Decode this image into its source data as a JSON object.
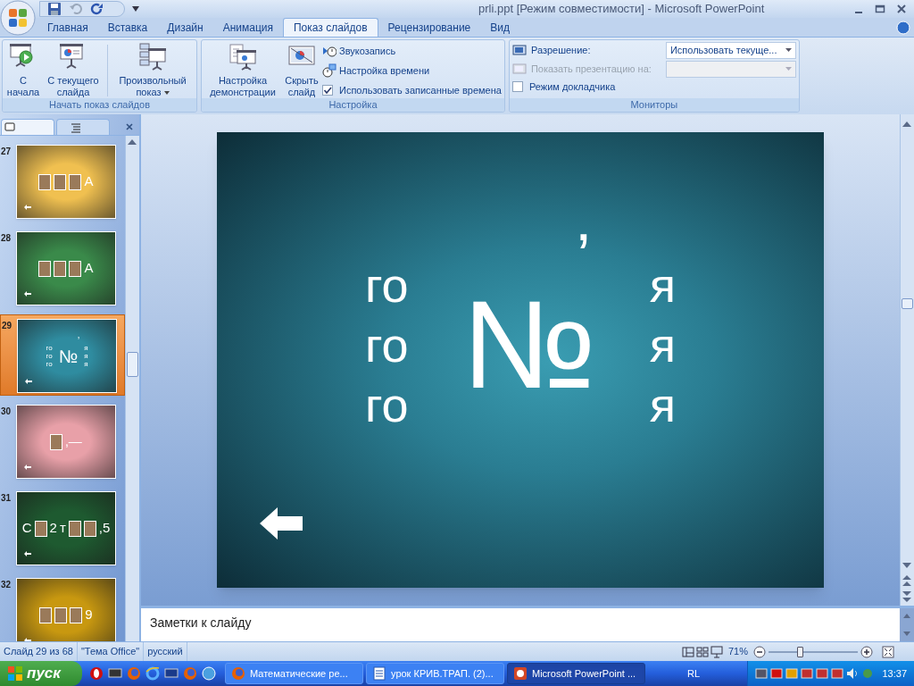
{
  "window": {
    "title": "prli.ppt [Режим совместимости] - Microsoft PowerPoint"
  },
  "tabs": [
    {
      "label": "Главная",
      "selected": false
    },
    {
      "label": "Вставка",
      "selected": false
    },
    {
      "label": "Дизайн",
      "selected": false
    },
    {
      "label": "Анимация",
      "selected": false
    },
    {
      "label": "Показ слайдов",
      "selected": true
    },
    {
      "label": "Рецензирование",
      "selected": false
    },
    {
      "label": "Вид",
      "selected": false
    }
  ],
  "ribbon_groups": [
    {
      "title": "Начать показ слайдов",
      "controls": [
        {
          "kind": "large",
          "label": "С начала"
        },
        {
          "kind": "large",
          "label": "С текущего слайда"
        },
        {
          "kind": "separator"
        },
        {
          "kind": "large",
          "label": "Произвольный показ",
          "dropdown": true
        }
      ]
    },
    {
      "title": "Настройка",
      "controls": [
        {
          "kind": "large",
          "label": "Настройка демонстрации"
        },
        {
          "kind": "large",
          "label": "Скрыть слайд"
        },
        {
          "kind": "small",
          "label": "Звукозапись"
        },
        {
          "kind": "small",
          "label": "Настройка времени"
        },
        {
          "kind": "checkbox",
          "label": "Использовать записанные времена",
          "checked": true
        }
      ]
    },
    {
      "title": "Мониторы",
      "controls": [
        {
          "kind": "select",
          "label": "Разрешение:",
          "value": "Использовать текуще...",
          "disabled": false
        },
        {
          "kind": "select",
          "label": "Показать презентацию на:",
          "disabled": true
        },
        {
          "kind": "checkbox",
          "label": "Режим докладчика",
          "checked": false
        }
      ]
    }
  ],
  "pane_tabs": [
    {
      "selected": true
    },
    {
      "selected": false
    }
  ],
  "thumbnails": [
    {
      "number": "27",
      "selected": false,
      "color": "#f0c050",
      "items": [
        {
          "kind": "photo"
        },
        {
          "kind": "photo"
        },
        {
          "kind": "photo"
        },
        {
          "kind": "text",
          "text": "А"
        }
      ]
    },
    {
      "number": "28",
      "selected": false,
      "color": "#3a8a4a",
      "items": [
        {
          "kind": "photo"
        },
        {
          "kind": "photo"
        },
        {
          "kind": "photo"
        },
        {
          "kind": "text",
          "text": "А"
        }
      ]
    },
    {
      "number": "29",
      "selected": true,
      "color": "#2f8ca0",
      "items": [
        {
          "kind": "stack",
          "texts": [
            "го",
            "го",
            "го"
          ]
        },
        {
          "kind": "accented",
          "text": "№",
          "accent": "ʼ"
        },
        {
          "kind": "stack",
          "texts": [
            "я",
            "я",
            "я"
          ]
        }
      ]
    },
    {
      "number": "30",
      "selected": false,
      "color": "#e8a0a8",
      "items": [
        {
          "kind": "photo"
        },
        {
          "kind": "text",
          "text": "‚—"
        }
      ]
    },
    {
      "number": "31",
      "selected": false,
      "color": "#1e5a30",
      "items": [
        {
          "kind": "text",
          "text": "С"
        },
        {
          "kind": "photo"
        },
        {
          "kind": "text",
          "text": "2"
        },
        {
          "kind": "text",
          "text": "т"
        },
        {
          "kind": "photo"
        },
        {
          "kind": "photo"
        },
        {
          "kind": "text",
          "text": ",5"
        }
      ]
    },
    {
      "number": "32",
      "selected": false,
      "color": "#c89810",
      "items": [
        {
          "kind": "photo"
        },
        {
          "kind": "photo"
        },
        {
          "kind": "photo"
        },
        {
          "kind": "text",
          "text": "9"
        }
      ]
    }
  ],
  "slide": {
    "left": [
      "го",
      "го",
      "го"
    ],
    "center": "№",
    "accent": "ʼ",
    "right": [
      "я",
      "я",
      "я"
    ]
  },
  "notes": {
    "placeholder": "Заметки к слайду"
  },
  "status_bar": {
    "items": [
      "Слайд 29 из 68",
      "\"Тема Office\"",
      "русский"
    ],
    "zoom": "71%",
    "zoom_level": {
      "level": 0.35
    }
  },
  "taskbar": {
    "start": "пуск",
    "tasks": [
      {
        "label": "Математические ре...",
        "selected": false
      },
      {
        "label": "урок КРИВ.ТРАП. (2)...",
        "selected": false
      },
      {
        "label": "Microsoft PowerPoint ...",
        "selected": true
      }
    ],
    "language": "RL",
    "time": "13:37"
  }
}
